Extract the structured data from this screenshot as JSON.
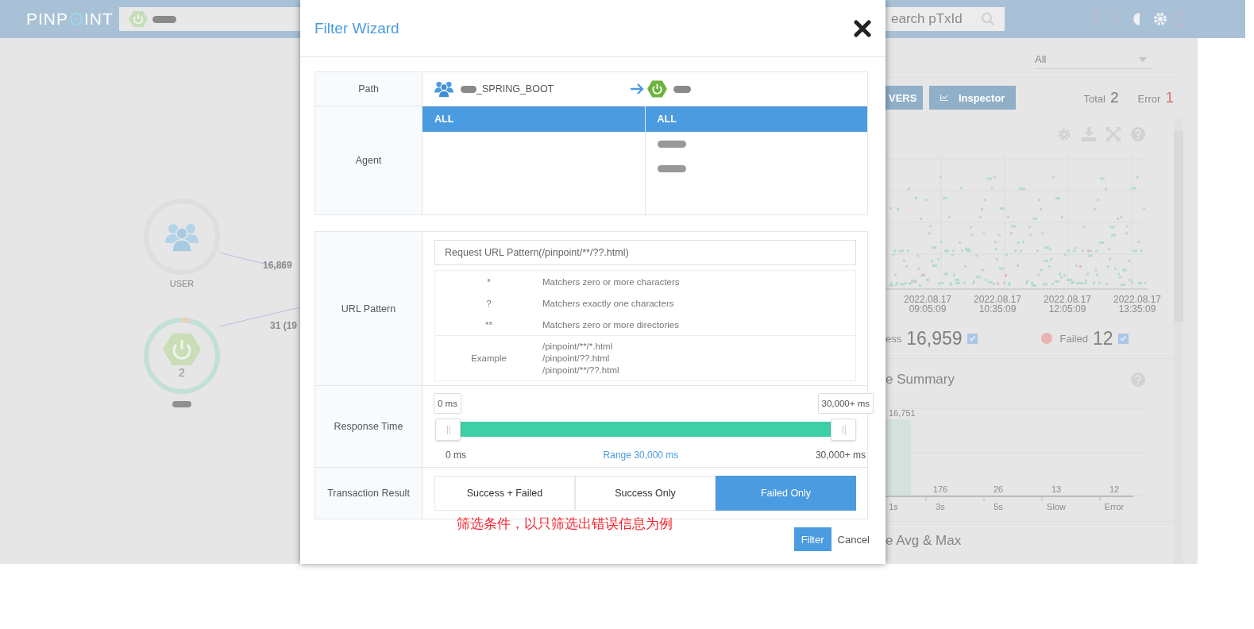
{
  "header": {
    "logo": {
      "left": "PINP",
      "right": "INT"
    },
    "search": {
      "placeholder": "earch pTxId"
    }
  },
  "server_map": {
    "nodes": [
      {
        "kind": "user",
        "label": "USER"
      },
      {
        "kind": "spring",
        "count": "2"
      }
    ],
    "edges": [
      {
        "label": "16,869"
      },
      {
        "label": "31 (19"
      }
    ]
  },
  "side_panel": {
    "filter_select": {
      "value": "All"
    },
    "buttons": [
      {
        "label": "VERS",
        "kind": "text"
      },
      {
        "label": "Inspector",
        "kind": "chart"
      }
    ],
    "totals": [
      {
        "label": "Total",
        "value": "2",
        "kind": "total"
      },
      {
        "label": "Error",
        "value": "1",
        "kind": "error"
      }
    ],
    "scatter": {
      "x_labels": [
        {
          "date": "2022.08.17",
          "time": "09:05:09"
        },
        {
          "date": "2022.08.17",
          "time": "10:35:09"
        },
        {
          "date": "2022.08.17",
          "time": "12:05:09"
        },
        {
          "date": "2022.08.17",
          "time": "13:35:09"
        }
      ]
    },
    "legend": [
      {
        "kind": "success",
        "label": "ess",
        "value": "16,959",
        "checked": true
      },
      {
        "kind": "failed",
        "label": "Failed",
        "value": "12",
        "checked": true
      }
    ],
    "summary": {
      "title": "e Summary",
      "chart_data": {
        "type": "bar",
        "categories": [
          "1s",
          "3s",
          "5s",
          "Slow",
          "Error"
        ],
        "values": [
          16751,
          176,
          26,
          13,
          12
        ],
        "value_labels": [
          "16,751",
          "176",
          "26",
          "13",
          "12"
        ]
      }
    },
    "avg_max": {
      "title": "e Avg & Max"
    }
  },
  "modal": {
    "title": "Filter Wizard",
    "path": {
      "label": "Path",
      "from": {
        "name": "_SPRING_BOOT"
      }
    },
    "agent": {
      "label": "Agent",
      "columns": [
        {
          "header": {
            "label": "ALL",
            "selected": true
          }
        },
        {
          "header": {
            "label": "ALL",
            "selected": true
          },
          "items": [
            {
              "kind": "redacted"
            },
            {
              "kind": "redacted"
            }
          ]
        }
      ]
    },
    "url_pattern": {
      "label": "URL Pattern",
      "placeholder": "Request URL Pattern(/pinpoint/**/??.html)",
      "help": [
        {
          "symbol": "*",
          "text": "Matchers zero or more characters"
        },
        {
          "symbol": "?",
          "text": "Matchers exactly one characters"
        },
        {
          "symbol": "**",
          "text": "Matchers zero or more directories"
        }
      ],
      "example": {
        "label": "Example",
        "lines": [
          "/pinpoint/**/*.html",
          "/pinpoint/??.html",
          "/pinpoint/**/??.html"
        ]
      }
    },
    "response_time": {
      "label": "Response Time",
      "low": {
        "value": "0 ms",
        "level": 0
      },
      "high": {
        "value": "30,000+ ms",
        "level": 1
      },
      "min_label": "0 ms",
      "range_label": "Range 30,000 ms",
      "max_label": "30,000+ ms"
    },
    "transaction_result": {
      "label": "Transaction Result",
      "options": [
        {
          "label": "Success + Failed",
          "selected": false
        },
        {
          "label": "Success Only",
          "selected": false
        },
        {
          "label": "Failed Only",
          "selected": true
        }
      ]
    },
    "annotation": "筛选条件，以只筛选出错误信息为例",
    "buttons": [
      {
        "label": "Filter",
        "kind": "primary"
      },
      {
        "label": "Cancel",
        "kind": "link"
      }
    ]
  }
}
